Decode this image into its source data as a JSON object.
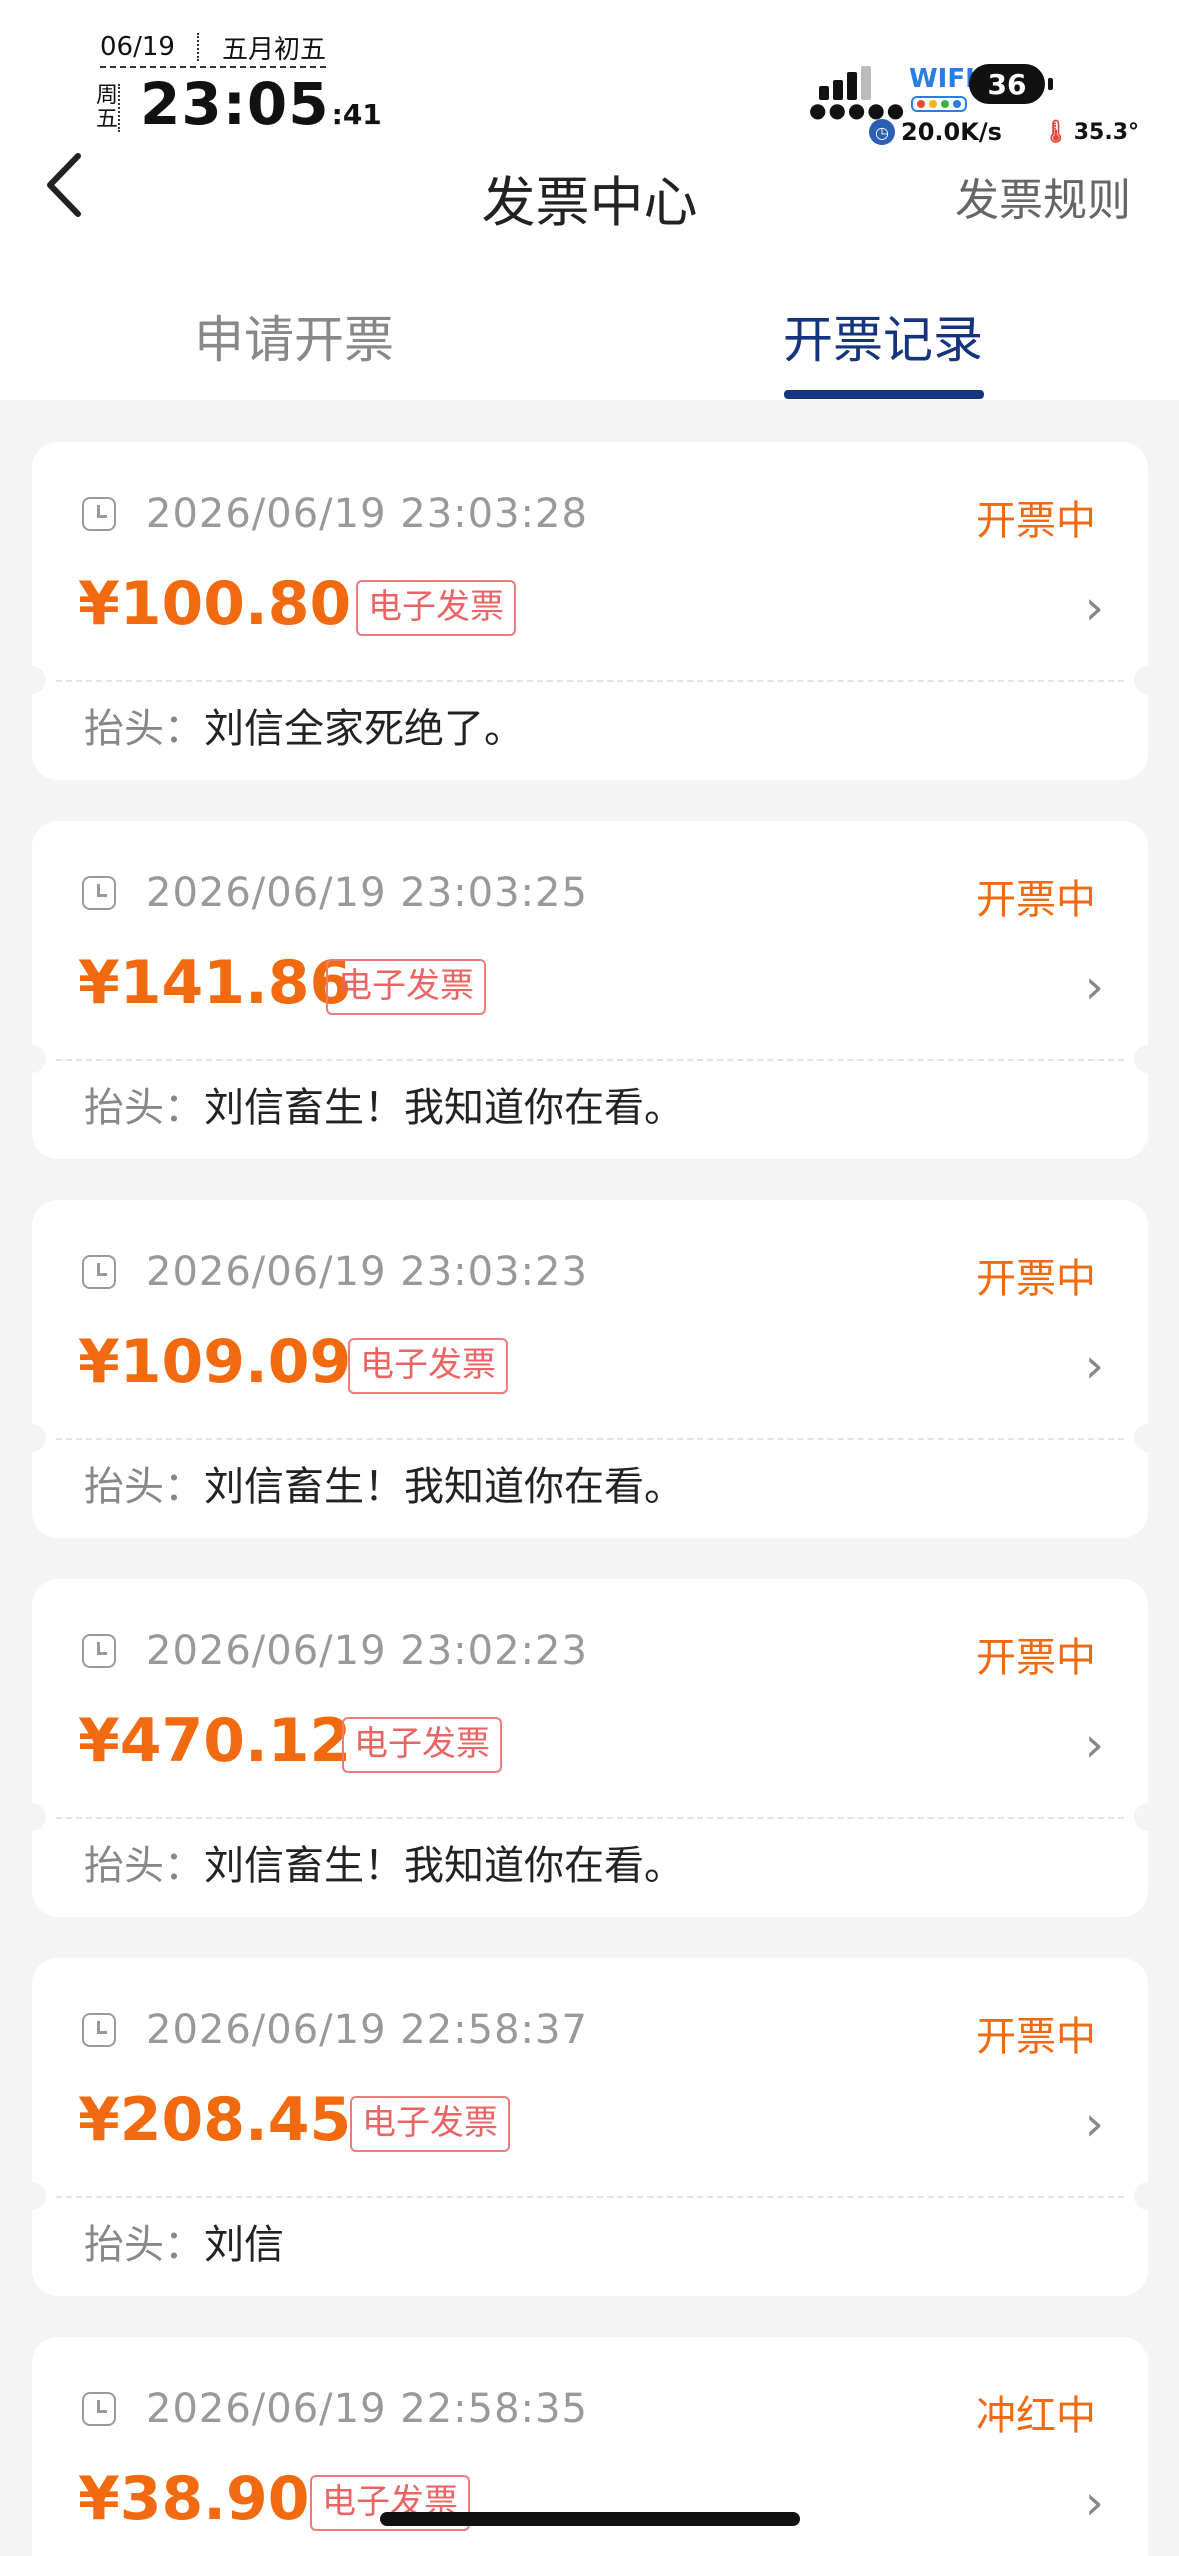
{
  "status_bar": {
    "date": "06/19",
    "lunar": "五月初五",
    "weekday": "周五",
    "time_hm": "23:05",
    "time_s": ":41",
    "wifi_label": "WIFI",
    "battery": "36",
    "net_speed": "20.0K/s",
    "temperature": "35.3°",
    "icons": [
      "signal-icon",
      "wifi-icon",
      "battery-icon",
      "clock-icon",
      "thermometer-icon"
    ]
  },
  "nav": {
    "back_icon": "chevron-left-icon",
    "title": "发票中心",
    "rules_link": "发票规则"
  },
  "tabs": [
    {
      "label": "申请开票",
      "active": false
    },
    {
      "label": "开票记录",
      "active": true
    }
  ],
  "colors": {
    "accent_blue": "#14357e",
    "status_orange": "#f06a12",
    "amount_orange": "#f26a10",
    "tag_red": "#ea6464"
  },
  "records": [
    {
      "time": "2026/06/19 23:03:28",
      "status": "开票中",
      "amount": "¥100.80",
      "type": "电子发票",
      "title_label": "抬头：",
      "title": "刘信全家死绝了。"
    },
    {
      "time": "2026/06/19 23:03:25",
      "status": "开票中",
      "amount": "¥141.86",
      "type": "电子发票",
      "title_label": "抬头：",
      "title": "刘信畜生！我知道你在看。"
    },
    {
      "time": "2026/06/19 23:03:23",
      "status": "开票中",
      "amount": "¥109.09",
      "type": "电子发票",
      "title_label": "抬头：",
      "title": "刘信畜生！我知道你在看。"
    },
    {
      "time": "2026/06/19 23:02:23",
      "status": "开票中",
      "amount": "¥470.12",
      "type": "电子发票",
      "title_label": "抬头：",
      "title": "刘信畜生！我知道你在看。"
    },
    {
      "time": "2026/06/19 22:58:37",
      "status": "开票中",
      "amount": "¥208.45",
      "type": "电子发票",
      "title_label": "抬头：",
      "title": "刘信"
    },
    {
      "time": "2026/06/19 22:58:35",
      "status": "冲红中",
      "amount": "¥38.90",
      "type": "电子发票",
      "title_label": "",
      "title": ""
    }
  ]
}
